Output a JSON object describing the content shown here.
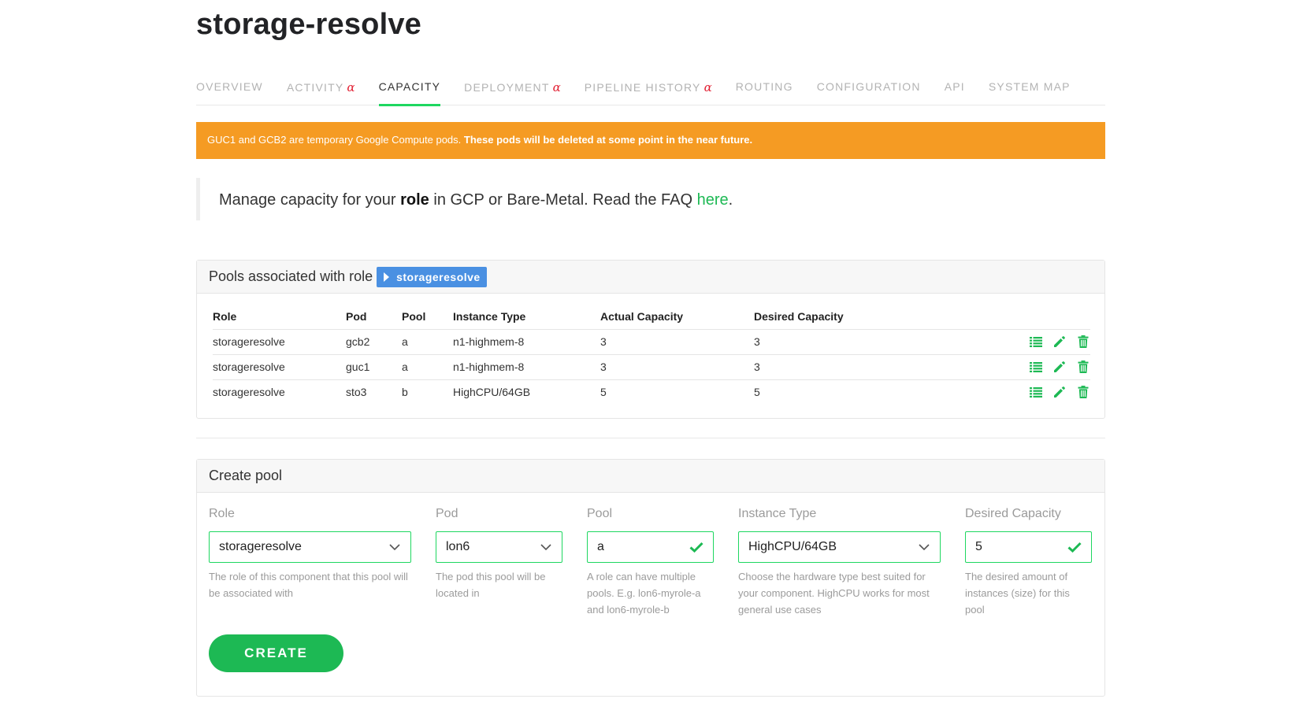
{
  "page": {
    "title": "storage-resolve"
  },
  "tabs": [
    {
      "label": "OVERVIEW",
      "alpha": ""
    },
    {
      "label": "ACTIVITY",
      "alpha": "α"
    },
    {
      "label": "CAPACITY",
      "alpha": ""
    },
    {
      "label": "DEPLOYMENT",
      "alpha": "α"
    },
    {
      "label": "PIPELINE HISTORY",
      "alpha": "α"
    },
    {
      "label": "ROUTING",
      "alpha": ""
    },
    {
      "label": "CONFIGURATION",
      "alpha": ""
    },
    {
      "label": "API",
      "alpha": ""
    },
    {
      "label": "SYSTEM MAP",
      "alpha": ""
    }
  ],
  "banner": {
    "text": "GUC1 and GCB2 are temporary Google Compute pods.",
    "bold": "These pods will be deleted at some point in the near future."
  },
  "intro": {
    "prefix": "Manage capacity for your",
    "bold": "role",
    "middle": "in GCP or Bare-Metal. Read the FAQ",
    "link": "here",
    "suffix": "."
  },
  "pools": {
    "heading": "Pools associated with role",
    "role_pill": "storageresolve",
    "columns": [
      "Role",
      "Pod",
      "Pool",
      "Instance Type",
      "Actual Capacity",
      "Desired Capacity"
    ],
    "rows": [
      {
        "role": "storageresolve",
        "pod": "gcb2",
        "pool": "a",
        "instance_type": "n1-highmem-8",
        "actual": "3",
        "desired": "3"
      },
      {
        "role": "storageresolve",
        "pod": "guc1",
        "pool": "a",
        "instance_type": "n1-highmem-8",
        "actual": "3",
        "desired": "3"
      },
      {
        "role": "storageresolve",
        "pod": "sto3",
        "pool": "b",
        "instance_type": "HighCPU/64GB",
        "actual": "5",
        "desired": "5"
      }
    ]
  },
  "create": {
    "heading": "Create pool",
    "role": {
      "label": "Role",
      "value": "storageresolve",
      "help": "The role of this component that this pool will be associated with"
    },
    "pod": {
      "label": "Pod",
      "value": "lon6",
      "help": "The pod this pool will be located in"
    },
    "pool": {
      "label": "Pool",
      "value": "a",
      "help": "A role can have multiple pools. E.g. lon6-myrole-a and lon6-myrole-b"
    },
    "instance_type": {
      "label": "Instance Type",
      "value": "HighCPU/64GB",
      "help": "Choose the hardware type best suited for your component. HighCPU works for most general use cases"
    },
    "desired_capacity": {
      "label": "Desired Capacity",
      "value": "5",
      "help": "The desired amount of instances (size) for this pool"
    },
    "button": "CREATE"
  },
  "colors": {
    "accent": "#1ed760",
    "button": "#1db954",
    "banner": "#f59b23",
    "pill": "#4a90e2",
    "alpha": "#e22134"
  },
  "icons": {
    "row_actions": [
      "list-icon",
      "pencil-icon",
      "trash-icon"
    ],
    "select": "chevron-down-icon",
    "valid": "checkmark-icon"
  }
}
